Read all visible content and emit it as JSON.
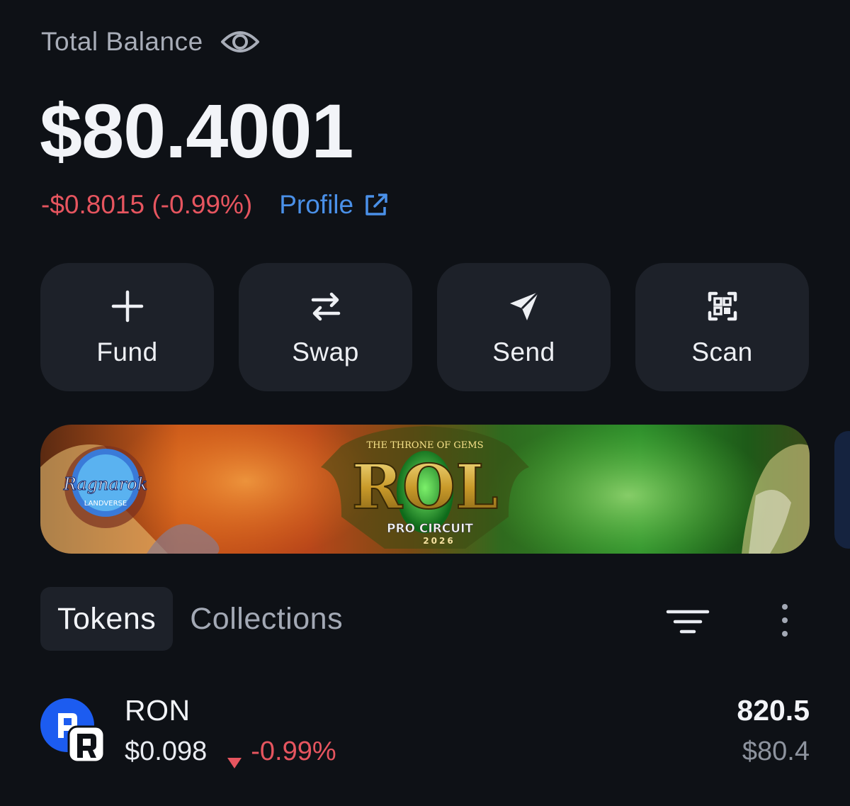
{
  "balance": {
    "label": "Total Balance",
    "amount": "$80.4001",
    "change": "-$0.8015 (-0.99%)",
    "profile_link": "Profile"
  },
  "actions": [
    {
      "label": "Fund",
      "icon": "plus-icon"
    },
    {
      "label": "Swap",
      "icon": "swap-arrows-icon"
    },
    {
      "label": "Send",
      "icon": "send-arrow-icon"
    },
    {
      "label": "Scan",
      "icon": "scan-qr-icon"
    }
  ],
  "banner": {
    "top_text": "THE THRONE OF GEMS",
    "title": "ROL",
    "subtitle": "PRO CIRCUIT",
    "year": "2026",
    "logo_text": "Ragnarok",
    "logo_sub": "LANDVERSE"
  },
  "tabs": [
    {
      "label": "Tokens",
      "active": true
    },
    {
      "label": "Collections",
      "active": false
    }
  ],
  "tokens": [
    {
      "symbol": "RON",
      "price": "$0.098",
      "change": "-0.99%",
      "amount": "820.5",
      "value": "$80.4"
    }
  ],
  "colors": {
    "background": "#0e1116",
    "card": "#1d2129",
    "negative": "#e6555f",
    "link": "#4a90e8",
    "ron_blue": "#1c5cf0"
  }
}
